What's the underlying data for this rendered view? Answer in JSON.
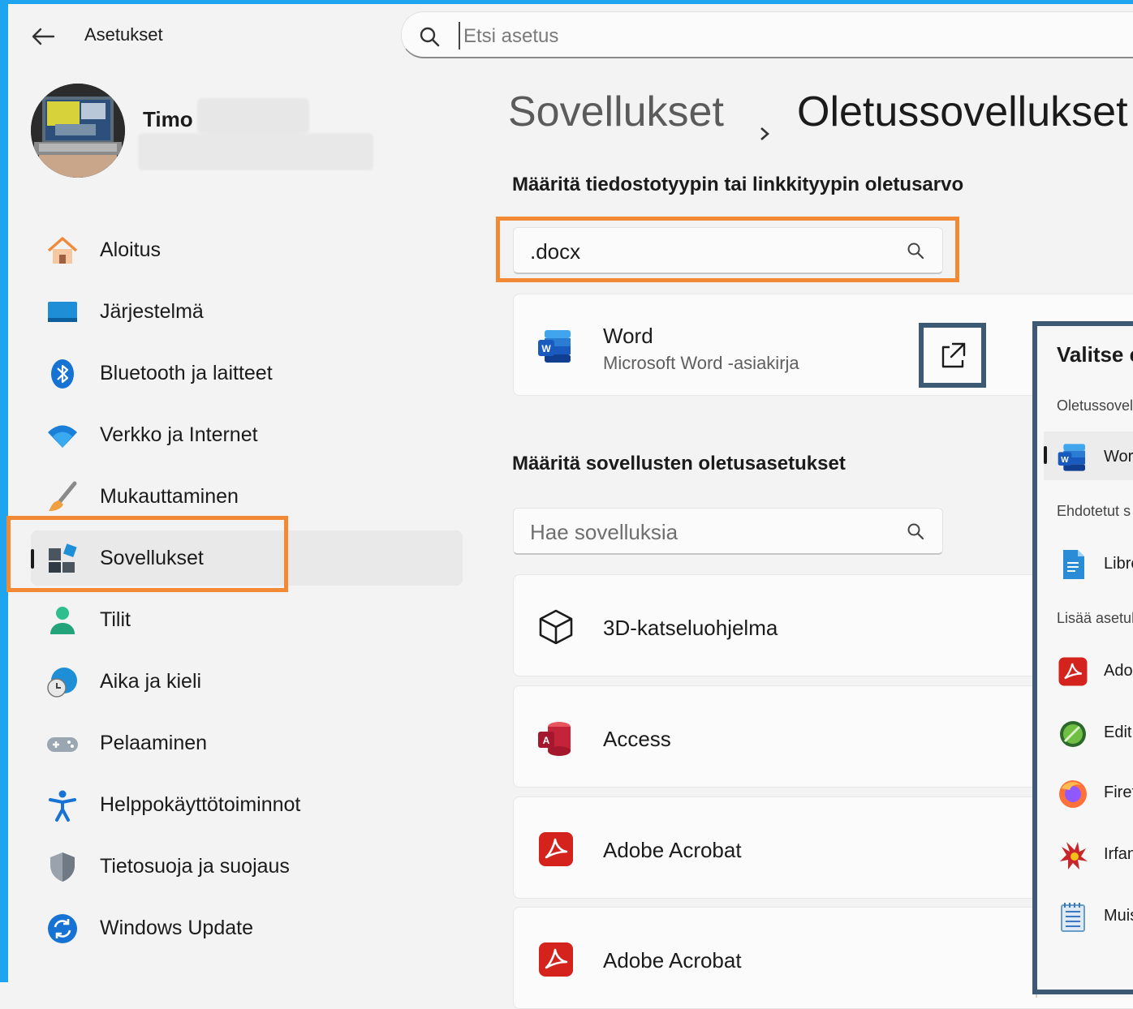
{
  "window": {
    "title": "Asetukset"
  },
  "search": {
    "placeholder": "Etsi asetus"
  },
  "user": {
    "name": "Timo"
  },
  "sidebar": {
    "items": [
      {
        "label": "Aloitus"
      },
      {
        "label": "Järjestelmä"
      },
      {
        "label": "Bluetooth ja laitteet"
      },
      {
        "label": "Verkko ja Internet"
      },
      {
        "label": "Mukauttaminen"
      },
      {
        "label": "Sovellukset"
      },
      {
        "label": "Tilit"
      },
      {
        "label": "Aika ja kieli"
      },
      {
        "label": "Pelaaminen"
      },
      {
        "label": "Helppokäyttötoiminnot"
      },
      {
        "label": "Tietosuoja ja suojaus"
      },
      {
        "label": "Windows Update"
      }
    ],
    "selected": "Sovellukset"
  },
  "breadcrumb": {
    "parent": "Sovellukset",
    "current": "Oletussovellukset"
  },
  "filetype": {
    "heading": "Määritä tiedostotyypin tai linkkityypin oletusarvo",
    "query": ".docx",
    "result": {
      "app": "Word",
      "description": "Microsoft Word -asiakirja"
    }
  },
  "apps": {
    "heading": "Määritä sovellusten oletusasetukset",
    "search_placeholder": "Hae sovelluksia",
    "list": [
      {
        "name": "3D-katseluohjelma"
      },
      {
        "name": "Access"
      },
      {
        "name": "Adobe Acrobat"
      },
      {
        "name": "Adobe Acrobat"
      }
    ]
  },
  "flyout": {
    "title": "Valitse c",
    "current_label": "Oletussovel",
    "current_app": "Word",
    "suggested_label": "Ehdotetut s",
    "suggested_app": "Libre",
    "more_label": "Lisää asetuk",
    "more_apps": [
      "Adol",
      "EditF",
      "Firef",
      "Irfan",
      "Muis"
    ]
  },
  "colors": {
    "highlight_orange": "#f28a35",
    "highlight_navy": "#3c5a74",
    "frame": "#1fa5f0"
  }
}
